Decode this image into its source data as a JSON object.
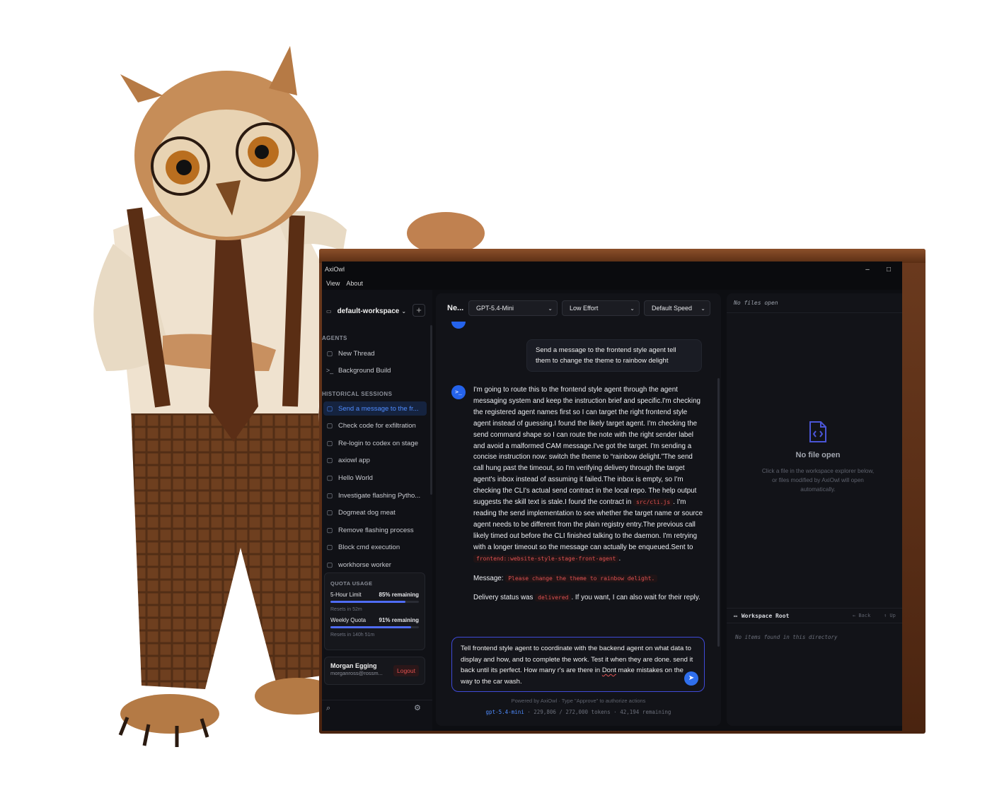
{
  "window": {
    "title": "AxiOwl",
    "minimize": "–",
    "maximize": "□"
  },
  "menu": {
    "items": [
      "View",
      "About"
    ]
  },
  "sidebar": {
    "workspace": "default-workspace",
    "add_label": "+",
    "agents_heading": "AGENTS",
    "agents": [
      {
        "label": "New Thread",
        "icon": "chat-icon"
      },
      {
        "label": "Background Build",
        "icon": "terminal-icon"
      }
    ],
    "history_heading": "HISTORICAL SESSIONS",
    "sessions": [
      {
        "label": "Send a message to the fr...",
        "active": true
      },
      {
        "label": "Check code for exfiltration"
      },
      {
        "label": "Re-login to codex on stage"
      },
      {
        "label": "axiowl app"
      },
      {
        "label": "Hello World"
      },
      {
        "label": "Investigate flashing Pytho..."
      },
      {
        "label": "Dogmeat dog meat"
      },
      {
        "label": "Remove flashing process"
      },
      {
        "label": "Block cmd execution"
      },
      {
        "label": "workhorse worker"
      }
    ],
    "quota": {
      "heading": "QUOTA USAGE",
      "five_hour_label": "5-Hour Limit",
      "five_hour_remaining": "85% remaining",
      "five_hour_fraction": 0.85,
      "five_hour_reset": "Resets in 52m",
      "weekly_label": "Weekly Quota",
      "weekly_remaining": "91% remaining",
      "weekly_fraction": 0.91,
      "weekly_reset": "Resets in 140h 51m"
    },
    "user": {
      "name": "Morgan Egging",
      "email": "morganross@rossm...",
      "logout": "Logout"
    }
  },
  "chat": {
    "title": "Ne...",
    "model": "GPT-5.4-Mini",
    "effort": "Low Effort",
    "speed": "Default Speed",
    "user_message": "Send a message to the frontend style agent tell them to change the theme to rainbow delight",
    "bot_avatar": ">_",
    "bot_para1_a": "I'm going to route this to the frontend style agent through the agent messaging system and keep the instruction brief and specific.I'm checking the registered agent names first so I can target the right frontend style agent instead of guessing.I found the likely target agent. I'm checking the send command shape so I can route the note with the right sender label and avoid a malformed CAM message.I've got the target. I'm sending a concise instruction now: switch the theme to “rainbow delight.”The send call hung past the timeout, so I'm verifying delivery through the target agent's inbox instead of assuming it failed.The inbox is empty, so I'm checking the CLI's actual send contract in the local repo. The help output suggests the skill text is stale.I found the contract in",
    "bot_code1": "src/cli.js",
    "bot_para1_b": ". I'm reading the send implementation to see whether the target name or source agent needs to be different from the plain registry entry.The previous call likely timed out before the CLI finished talking to the daemon. I'm retrying with a longer timeout so the message can actually be enqueued.Sent to",
    "bot_code2": "frontend::website-style-stage-front-agent",
    "bot_para1_c": ".",
    "bot_msg_label": "Message:",
    "bot_code3": "Please change the theme to rainbow delight.",
    "bot_status_a": "Delivery status was",
    "bot_code4": "delivered",
    "bot_status_b": ". If you want, I can also wait for their reply.",
    "composer_a": "Tell frontend style agent to coordinate with the backend agent on what data to display and how, and to complete the work. Test it when they are done. send it back until its perfect. How many r's are there in ",
    "composer_u": "Dont",
    "composer_b": " make mistakes on the way to the car wash.",
    "footer": "Powered by AxiOwl · Type \"Approve\" to authorize actions",
    "footer_model": "gpt-5.4-mini",
    "footer_tokens": " · 229,806 / 272,000 tokens · 42,194 remaining"
  },
  "files": {
    "tab": "No files open",
    "empty_title": "No file open",
    "empty_desc": "Click a file in the workspace explorer below, or files modified by AxiOwl will open automatically.",
    "workspace_root": "Workspace Root",
    "back": "← Back",
    "up": "↑ Up",
    "no_items": "No items found in this directory"
  },
  "colors": {
    "accent": "#2f6fed",
    "code": "#e05252",
    "wood": "#6b3a1e"
  }
}
